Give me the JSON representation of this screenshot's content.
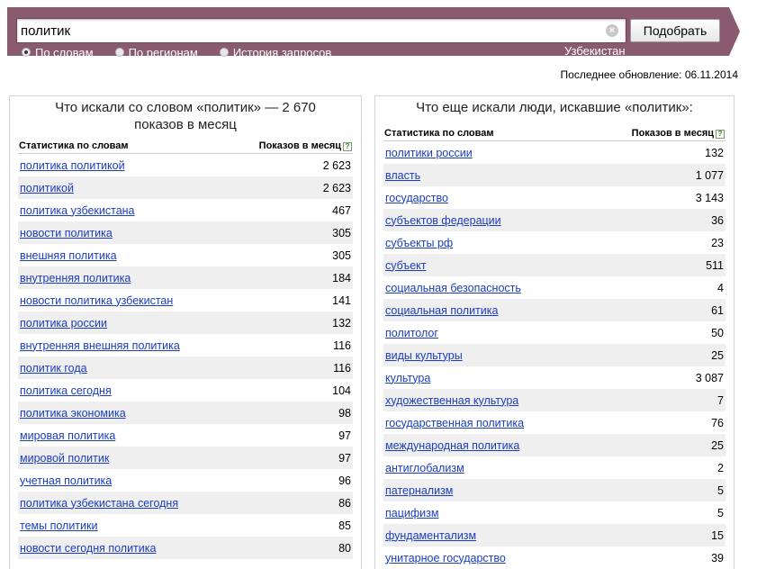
{
  "search": {
    "value": "политик",
    "submit_label": "Подобрать",
    "clear_glyph": "×"
  },
  "modes": [
    {
      "label": "По словам",
      "selected": true
    },
    {
      "label": "По регионам",
      "selected": false
    },
    {
      "label": "История запросов",
      "selected": false
    }
  ],
  "region": "Узбекистан",
  "last_update": "Последнее обновление: 06.11.2014",
  "left": {
    "title": "Что искали со словом «политик» — 2 670 показов в месяц",
    "col_query": "Статистика по словам",
    "col_count": "Показов в месяц",
    "help_glyph": "?",
    "rows": [
      {
        "q": "политика политикой",
        "n": "2 623"
      },
      {
        "q": "политикой",
        "n": "2 623"
      },
      {
        "q": "политика узбекистана",
        "n": "467"
      },
      {
        "q": "новости политика",
        "n": "305"
      },
      {
        "q": "внешняя политика",
        "n": "305"
      },
      {
        "q": "внутренняя политика",
        "n": "184"
      },
      {
        "q": "новости политика узбекистан",
        "n": "141"
      },
      {
        "q": "политика россии",
        "n": "132"
      },
      {
        "q": "внутренняя внешняя политика",
        "n": "116"
      },
      {
        "q": "политик года",
        "n": "116"
      },
      {
        "q": "политика сегодня",
        "n": "104"
      },
      {
        "q": "политика экономика",
        "n": "98"
      },
      {
        "q": "мировая политика",
        "n": "97"
      },
      {
        "q": "мировой политик",
        "n": "97"
      },
      {
        "q": "учетная политика",
        "n": "96"
      },
      {
        "q": "политика узбекистана сегодня",
        "n": "86"
      },
      {
        "q": "темы политики",
        "n": "85"
      },
      {
        "q": "новости сегодня политика",
        "n": "80"
      }
    ]
  },
  "right": {
    "title": "Что еще искали люди, искавшие «политик»:",
    "col_query": "Статистика по словам",
    "col_count": "Показов в месяц",
    "help_glyph": "?",
    "rows": [
      {
        "q": "политики россии",
        "n": "132"
      },
      {
        "q": "власть",
        "n": "1 077"
      },
      {
        "q": "государство",
        "n": "3 143"
      },
      {
        "q": "субъектов федерации",
        "n": "36"
      },
      {
        "q": "субъекты рф",
        "n": "23"
      },
      {
        "q": "субъект",
        "n": "511"
      },
      {
        "q": "социальная безопасность",
        "n": "4"
      },
      {
        "q": "социальная политика",
        "n": "61"
      },
      {
        "q": "политолог",
        "n": "50"
      },
      {
        "q": "виды культуры",
        "n": "25"
      },
      {
        "q": "культура",
        "n": "3 087"
      },
      {
        "q": "художественная культура",
        "n": "7"
      },
      {
        "q": "государственная политика",
        "n": "76"
      },
      {
        "q": "международная политика",
        "n": "25"
      },
      {
        "q": "антиглобализм",
        "n": "2"
      },
      {
        "q": "патернализм",
        "n": "5"
      },
      {
        "q": "пацифизм",
        "n": "5"
      },
      {
        "q": "фундаментализм",
        "n": "15"
      },
      {
        "q": "унитарное государство",
        "n": "39"
      }
    ]
  }
}
